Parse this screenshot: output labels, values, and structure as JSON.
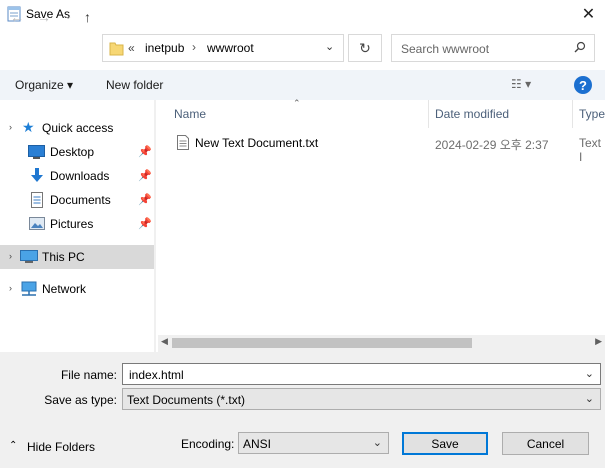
{
  "window": {
    "title": "Save As",
    "close_glyph": "✕"
  },
  "nav": {
    "breadcrumb": [
      "inetpub",
      "wwwroot"
    ],
    "overflow_glyph": "«",
    "sep_glyph": "›",
    "search_placeholder": "Search wwwroot"
  },
  "toolbar": {
    "organize_label": "Organize ▾",
    "new_folder_label": "New folder",
    "help_glyph": "?"
  },
  "sidebar": {
    "items": [
      {
        "label": "Quick access",
        "icon": "star-icon",
        "pinned": false
      },
      {
        "label": "Desktop",
        "icon": "desktop-icon",
        "pinned": true
      },
      {
        "label": "Downloads",
        "icon": "download-icon",
        "pinned": true
      },
      {
        "label": "Documents",
        "icon": "documents-icon",
        "pinned": true
      },
      {
        "label": "Pictures",
        "icon": "pictures-icon",
        "pinned": true
      },
      {
        "label": "This PC",
        "icon": "computer-icon",
        "pinned": false,
        "selected": true
      },
      {
        "label": "Network",
        "icon": "network-icon",
        "pinned": false
      }
    ]
  },
  "list": {
    "columns": [
      "Name",
      "Date modified",
      "Type"
    ],
    "rows": [
      {
        "name": "New Text Document.txt",
        "date": "2024-02-29 오후 2:37",
        "type": "Text I"
      }
    ]
  },
  "form": {
    "file_name_label": "File name:",
    "file_name_value": "index.html",
    "save_type_label": "Save as type:",
    "save_type_value": "Text Documents (*.txt)",
    "encoding_label": "Encoding:",
    "encoding_value": "ANSI",
    "hide_folders_label": "Hide Folders",
    "save_label": "Save",
    "cancel_label": "Cancel"
  },
  "colors": {
    "accent": "#0078d7",
    "selected_bg": "#d9d9d9",
    "toolbar_bg": "#f0f4f9"
  }
}
